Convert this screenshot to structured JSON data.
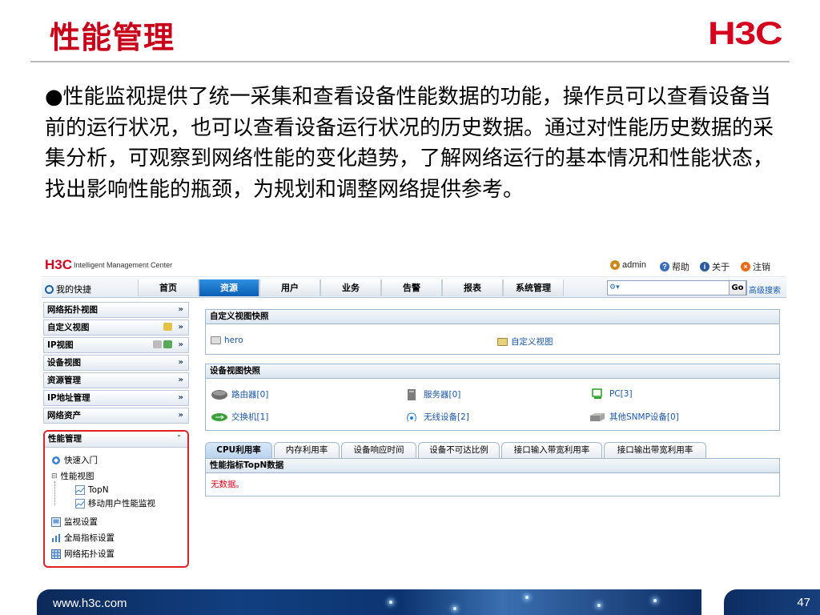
{
  "slide": {
    "title": "性能管理",
    "logo_text": "H3C",
    "body_paragraph": "●性能监视提供了统一采集和查看设备性能数据的功能，操作员可以查看设备当前的运行状况，也可以查看设备运行状况的历史数据。通过对性能历史数据的采集分析，可观察到网络性能的变化趋势，了解网络运行的基本情况和性能状态，找出影响性能的瓶颈，为规划和调整网络提供参考。"
  },
  "imc": {
    "logo": "H3C",
    "product": "Intelligent Management Center",
    "header_links": [
      {
        "label": "admin",
        "icon": "users-icon",
        "color": "#c98a1a"
      },
      {
        "label": "帮助",
        "icon": "help-icon",
        "color": "#3a6fb8"
      },
      {
        "label": "关于",
        "icon": "info-icon",
        "color": "#2b5b9e"
      },
      {
        "label": "注销",
        "icon": "logout-icon",
        "color": "#e86a1a"
      }
    ],
    "quick_access": "我的快捷",
    "nav_tabs": [
      "首页",
      "资源",
      "用户",
      "业务",
      "告警",
      "报表",
      "系统管理"
    ],
    "active_nav": "资源",
    "search": {
      "value": "",
      "go_label": "Go",
      "advanced_label": "高级搜索"
    },
    "sidebar": [
      {
        "label": "网络拓扑视图",
        "state": "collapsed"
      },
      {
        "label": "自定义视图",
        "state": "collapsed"
      },
      {
        "label": "IP视图",
        "state": "collapsed"
      },
      {
        "label": "设备视图",
        "state": "collapsed"
      },
      {
        "label": "资源管理",
        "state": "collapsed"
      },
      {
        "label": "IP地址管理",
        "state": "collapsed"
      },
      {
        "label": "网络资产",
        "state": "collapsed"
      }
    ],
    "perf_panel": {
      "label": "性能管理",
      "items": {
        "quick_start": "快速入门",
        "perf_view": "性能视图",
        "topn": "TopN",
        "mobile_monitor": "移动用户性能监视",
        "monitor_settings": "监视设置",
        "global_index": "全局指标设置",
        "topo_settings": "网络拓扑设置"
      }
    },
    "custom_view_panel": {
      "title": "自定义视图快照",
      "left_item": "hero",
      "right_item": "自定义视图"
    },
    "device_view_panel": {
      "title": "设备视图快照",
      "items": {
        "router": "路由器[0]",
        "server": "服务器[0]",
        "pc": "PC[3]",
        "switch": "交换机[1]",
        "wireless": "无线设备[2]",
        "snmp": "其他SNMP设备[0]"
      }
    },
    "perf_tabs": [
      "CPU利用率",
      "内存利用率",
      "设备响应时间",
      "设备不可达比例",
      "接口输入带宽利用率",
      "接口输出带宽利用率"
    ],
    "active_perf_tab": "CPU利用率",
    "topn_panel": {
      "title": "性能指标TopN数据",
      "message": "无数据。"
    }
  },
  "footer": {
    "url": "www.h3c.com",
    "page": "47"
  },
  "colors": {
    "title_red": "#c8001a",
    "brand_red": "#d5001e",
    "nav_blue": "#0a5fb5",
    "link_blue": "#1a56a6",
    "highlight_red": "#e0202a"
  }
}
